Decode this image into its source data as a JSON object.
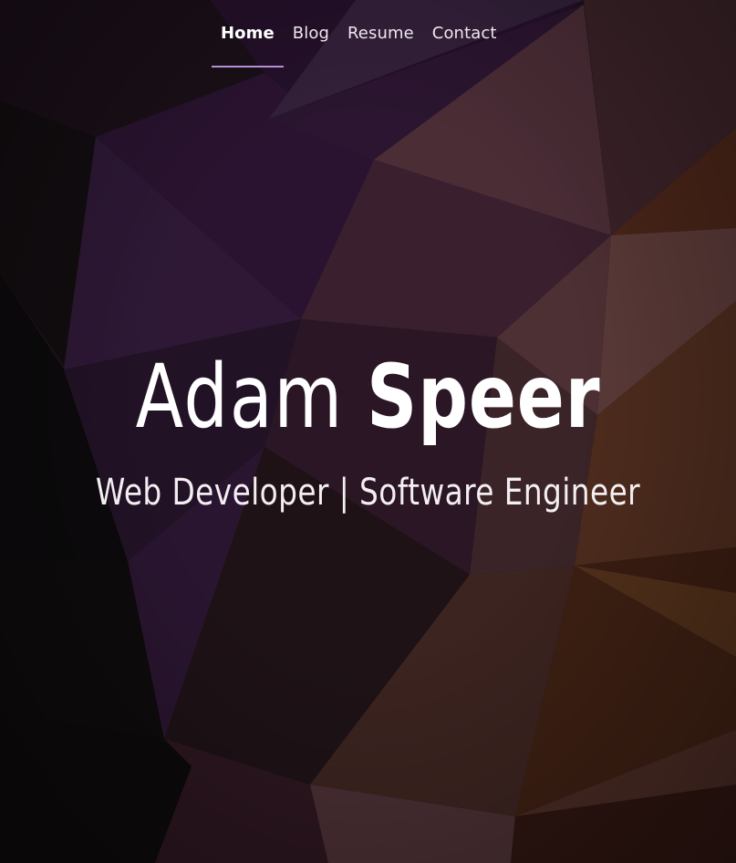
{
  "nav": {
    "items": [
      {
        "label": "Home",
        "active": true
      },
      {
        "label": "Blog",
        "active": false
      },
      {
        "label": "Resume",
        "active": false
      },
      {
        "label": "Contact",
        "active": false
      }
    ],
    "accent_color": "#b68fd6"
  },
  "hero": {
    "first_name": "Adam",
    "last_name": "Speer",
    "tagline": "Web Developer | Software Engineer"
  },
  "background": {
    "style": "low-poly geometric",
    "colors": [
      "#2a1030",
      "#3b1a3a",
      "#4a2a30",
      "#5a3028",
      "#1a1212",
      "#0c0a0c"
    ]
  }
}
